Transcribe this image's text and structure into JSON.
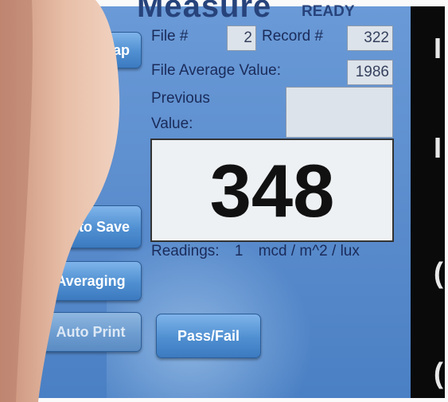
{
  "header": {
    "title": "Measure",
    "status": "READY"
  },
  "fields": {
    "file_label": "File #",
    "file_value": "2",
    "record_label": "Record #",
    "record_value": "322",
    "file_average_label": "File Average Value:",
    "file_average_value": "1986",
    "previous_label_line1": "Previous",
    "previous_label_line2": "Value:",
    "previous_value": ""
  },
  "display": {
    "value": "348"
  },
  "readings": {
    "label": "Readings:",
    "count": "1",
    "units": "mcd / m^2 / lux"
  },
  "buttons": {
    "snap_partial": "ap",
    "auto_save_partial": "uto Save",
    "averaging": "Averaging",
    "auto_print": "Auto Print",
    "pass_fail": "Pass/Fail"
  },
  "right_edge_glyphs": [
    "I",
    "I",
    "(",
    "("
  ],
  "colors": {
    "screen_blue": "#5d8ece",
    "button_blue": "#4f8fd1",
    "label_navy": "#1a2b5a",
    "title_navy": "#27437b"
  }
}
